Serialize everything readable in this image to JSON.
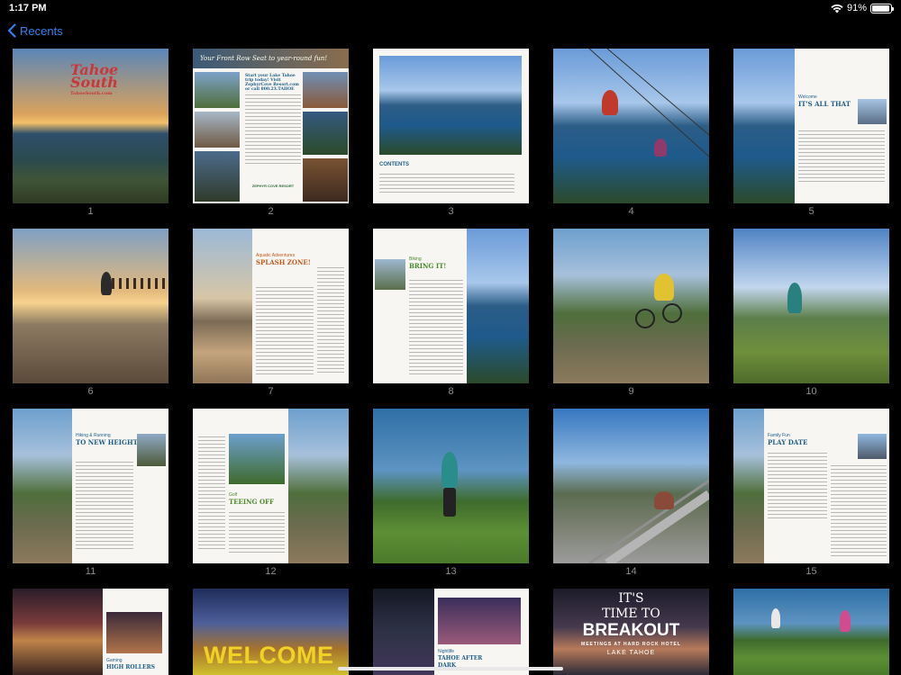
{
  "status_bar": {
    "time": "1:17 PM",
    "battery_percent": "91%",
    "battery_level": 0.91
  },
  "nav": {
    "back_label": "Recents"
  },
  "pages": {
    "p1": {
      "number": "1",
      "logo_line1": "Tahoe",
      "logo_line2": "South",
      "logo_url": "TahoeSouth.com"
    },
    "p2": {
      "number": "2",
      "banner": "Your Front Row Seat to year-round fun!",
      "headline": "Start your Lake Tahoe trip today! Visit ZephyrCove Resort.com or call 800.23.TAHOE",
      "brand": "ZEPHYR COVE RESORT"
    },
    "p3": {
      "number": "3",
      "contents_title": "CONTENTS"
    },
    "p4": {
      "number": "4"
    },
    "p5": {
      "number": "5",
      "kicker": "Welcome",
      "title": "IT'S ALL THAT"
    },
    "p6": {
      "number": "6"
    },
    "p7": {
      "number": "7",
      "kicker": "Aquatic Adventures",
      "title": "SPLASH ZONE!"
    },
    "p8": {
      "number": "8",
      "kicker": "Biking",
      "title": "BRING IT!"
    },
    "p9": {
      "number": "9"
    },
    "p10": {
      "number": "10"
    },
    "p11": {
      "number": "11",
      "kicker": "Hiking & Running",
      "title": "TO NEW HEIGHTS"
    },
    "p12": {
      "number": "12",
      "kicker": "Golf",
      "title": "TEEING OFF"
    },
    "p13": {
      "number": "13"
    },
    "p14": {
      "number": "14"
    },
    "p15": {
      "number": "15",
      "kicker": "Family Fun",
      "title": "PLAY DATE"
    },
    "p16": {
      "kicker": "Gaming",
      "title": "HIGH ROLLERS"
    },
    "p17": {
      "title": "WELCOME"
    },
    "p18": {
      "kicker": "Nightlife",
      "title": "TAHOE AFTER DARK"
    },
    "p19": {
      "line1": "IT'S",
      "line2": "TIME TO",
      "line3": "BREAKOUT",
      "line4": "MEETINGS AT HARD ROCK HOTEL",
      "line5": "LAKE TAHOE"
    },
    "p20": {}
  },
  "colors": {
    "accent": "#2f80ed",
    "page_number": "#8e8e93"
  }
}
